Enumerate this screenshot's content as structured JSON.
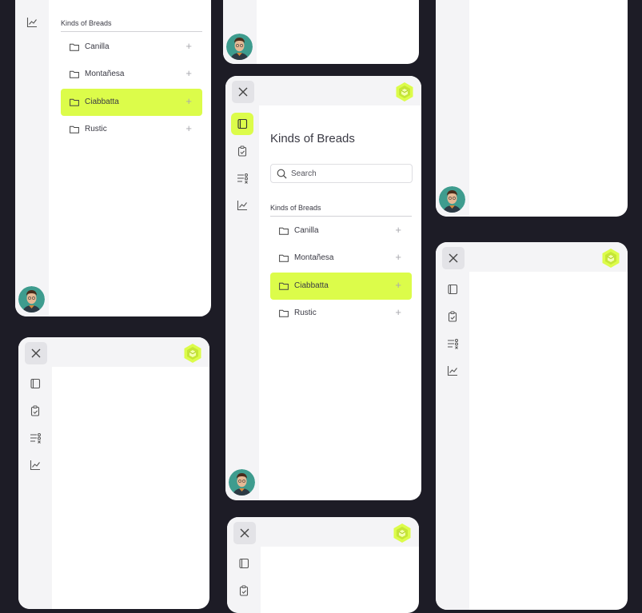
{
  "app": {
    "section_title": "Kinds of Breads",
    "search_placeholder": "Search",
    "list_header": "Kinds of Breads",
    "items": [
      {
        "label": "Canilla",
        "selected": false
      },
      {
        "label": "Montañesa",
        "selected": false
      },
      {
        "label": "Ciabbatta",
        "selected": true
      },
      {
        "label": "Rustic",
        "selected": false
      }
    ],
    "add_glyph": "+"
  },
  "icons": {
    "close": "close-icon",
    "logo": "cube-logo",
    "nav": [
      "notebook-icon",
      "clipboard-check-icon",
      "filter-list-icon",
      "line-chart-icon"
    ],
    "item": "folder-icon",
    "search": "search-icon"
  },
  "colors": {
    "background": "#1d1c26",
    "accent": "#dcfc4a",
    "rail": "#f4f4f6",
    "text": "#3a3a44"
  }
}
